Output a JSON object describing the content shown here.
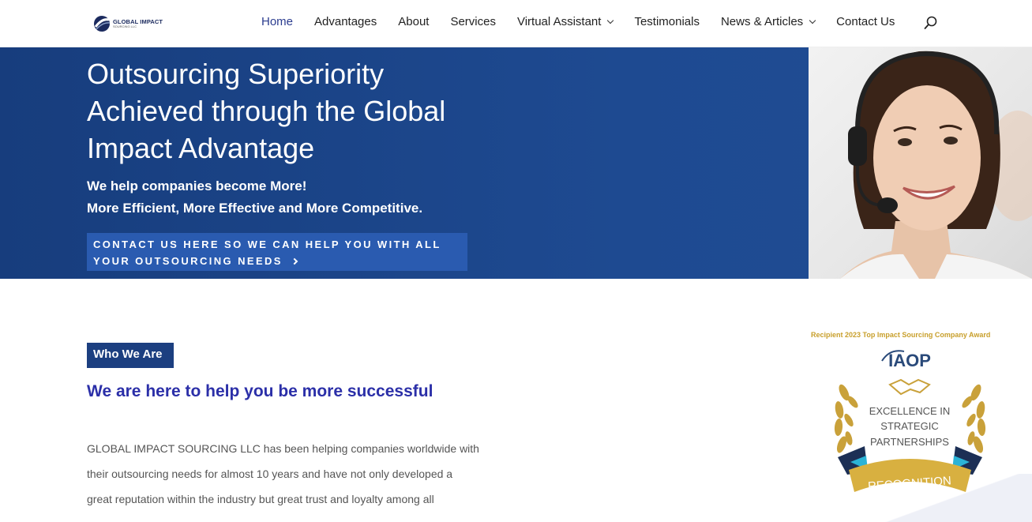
{
  "header": {
    "logo": {
      "title": "GLOBAL IMPACT",
      "subtitle": "SOURCING LLC"
    },
    "nav": [
      {
        "label": "Home",
        "active": true,
        "has_dropdown": false
      },
      {
        "label": "Advantages",
        "active": false,
        "has_dropdown": false
      },
      {
        "label": "About",
        "active": false,
        "has_dropdown": false
      },
      {
        "label": "Services",
        "active": false,
        "has_dropdown": false
      },
      {
        "label": "Virtual Assistant",
        "active": false,
        "has_dropdown": true
      },
      {
        "label": "Testimonials",
        "active": false,
        "has_dropdown": false
      },
      {
        "label": "News & Articles",
        "active": false,
        "has_dropdown": true
      },
      {
        "label": "Contact Us",
        "active": false,
        "has_dropdown": false
      }
    ],
    "search_icon": "search-icon"
  },
  "hero": {
    "title_lines": [
      "Outsourcing Superiority",
      "Achieved through the Global",
      "Impact Advantage"
    ],
    "subtitle_lines": [
      "We help companies become More!",
      "More Efficient, More Effective and More Competitive."
    ],
    "cta_lines": [
      "CONTACT US HERE SO WE CAN HELP YOU WITH ALL",
      "YOUR OUTSOURCING NEEDS"
    ],
    "photo": "customer-service-agent-with-headset"
  },
  "content": {
    "badge": "Who We Are",
    "heading": "We are here to help you be more successful",
    "body_lines": [
      "GLOBAL IMPACT SOURCING LLC has been helping companies worldwide with",
      "their outsourcing needs for almost 10 years and have not only developed a",
      "great reputation within the industry but great trust and loyalty among all"
    ]
  },
  "award": {
    "caption": "Recipient 2023 Top Impact Sourcing Company Award",
    "org": "IAOP",
    "lines": [
      "EXCELLENCE IN",
      "STRATEGIC",
      "PARTNERSHIPS"
    ],
    "year": "2023",
    "ribbon": "RECOGNITION"
  },
  "colors": {
    "brand_blue": "#1c3f80",
    "hero_blue": "#1e4a91",
    "cta_blue": "#2a5bb0",
    "heading_blue": "#2b2fa8",
    "gold": "#c89f2b",
    "nav_active": "#2b3c8f"
  }
}
